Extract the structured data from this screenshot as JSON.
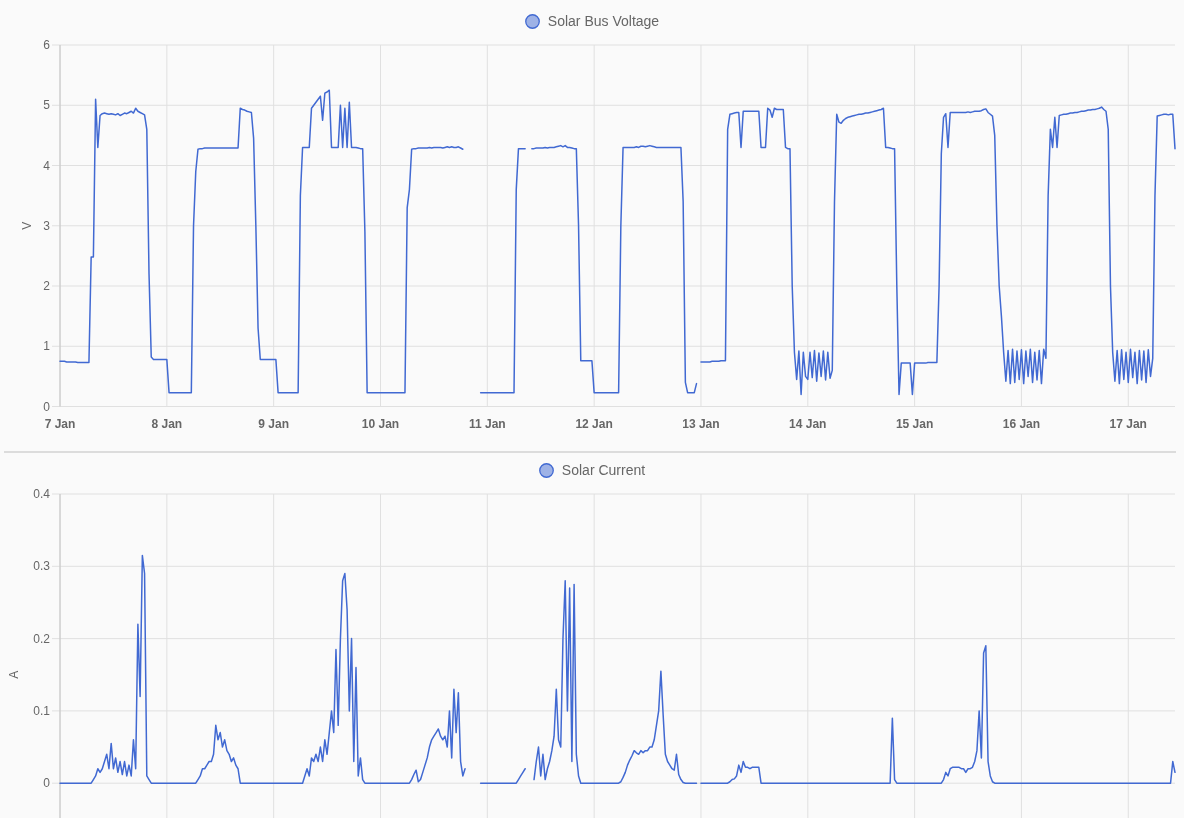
{
  "panels": [
    {
      "chart_data": {
        "type": "line",
        "ylabel": "V",
        "grid": true,
        "categories": [
          "7 Jan",
          null,
          null,
          null,
          null,
          null,
          null,
          null,
          null,
          null,
          null,
          null,
          null,
          null,
          null,
          null,
          null,
          null,
          null,
          null,
          null,
          null,
          null,
          null,
          null,
          null,
          null,
          null,
          null,
          null,
          null,
          null,
          null,
          null,
          null,
          null,
          null,
          null,
          null,
          null,
          null,
          null,
          null,
          null,
          null,
          null,
          null,
          null,
          "8 Jan",
          null,
          null,
          null,
          null,
          null,
          null,
          null,
          null,
          null,
          null,
          null,
          null,
          null,
          null,
          null,
          null,
          null,
          null,
          null,
          null,
          null,
          null,
          null,
          null,
          null,
          null,
          null,
          null,
          null,
          null,
          null,
          null,
          null,
          null,
          null,
          null,
          null,
          null,
          null,
          null,
          null,
          null,
          null,
          null,
          null,
          null,
          null,
          "9 Jan",
          null,
          null,
          null,
          null,
          null,
          null,
          null,
          null,
          null,
          null,
          null,
          null,
          null,
          null,
          null,
          null,
          null,
          null,
          null,
          null,
          null,
          null,
          null,
          null,
          null,
          null,
          null,
          null,
          null,
          null,
          null,
          null,
          null,
          null,
          null,
          null,
          null,
          null,
          null,
          null,
          null,
          null,
          null,
          null,
          null,
          null,
          null,
          "10 Jan",
          null,
          null,
          null,
          null,
          null,
          null,
          null,
          null,
          null,
          null,
          null,
          null,
          null,
          null,
          null,
          null,
          null,
          null,
          null,
          null,
          null,
          null,
          null,
          null,
          null,
          null,
          null,
          null,
          null,
          null,
          null,
          null,
          null,
          null,
          null,
          null,
          null,
          null,
          null,
          null,
          null,
          null,
          null,
          null,
          null,
          null,
          null,
          "11 Jan",
          null,
          null,
          null,
          null,
          null,
          null,
          null,
          null,
          null,
          null,
          null,
          null,
          null,
          null,
          null,
          null,
          null,
          null,
          null,
          null,
          null,
          null,
          null,
          null,
          null,
          null,
          null,
          null,
          null,
          null,
          null,
          null,
          null,
          null,
          null,
          null,
          null,
          null,
          null,
          null,
          null,
          null,
          null,
          null,
          null,
          null,
          null,
          "12 Jan",
          null,
          null,
          null,
          null,
          null,
          null,
          null,
          null,
          null,
          null,
          null,
          null,
          null,
          null,
          null,
          null,
          null,
          null,
          null,
          null,
          null,
          null,
          null,
          null,
          null,
          null,
          null,
          null,
          null,
          null,
          null,
          null,
          null,
          null,
          null,
          null,
          null,
          null,
          null,
          null,
          null,
          null,
          null,
          null,
          null,
          null,
          null,
          "13 Jan",
          null,
          null,
          null,
          null,
          null,
          null,
          null,
          null,
          null,
          null,
          null,
          null,
          null,
          null,
          null,
          null,
          null,
          null,
          null,
          null,
          null,
          null,
          null,
          null,
          null,
          null,
          null,
          null,
          null,
          null,
          null,
          null,
          null,
          null,
          null,
          null,
          null,
          null,
          null,
          null,
          null,
          null,
          null,
          null,
          null,
          null,
          null,
          "14 Jan",
          null,
          null,
          null,
          null,
          null,
          null,
          null,
          null,
          null,
          null,
          null,
          null,
          null,
          null,
          null,
          null,
          null,
          null,
          null,
          null,
          null,
          null,
          null,
          null,
          null,
          null,
          null,
          null,
          null,
          null,
          null,
          null,
          null,
          null,
          null,
          null,
          null,
          null,
          null,
          null,
          null,
          null,
          null,
          null,
          null,
          null,
          null,
          "15 Jan",
          null,
          null,
          null,
          null,
          null,
          null,
          null,
          null,
          null,
          null,
          null,
          null,
          null,
          null,
          null,
          null,
          null,
          null,
          null,
          null,
          null,
          null,
          null,
          null,
          null,
          null,
          null,
          null,
          null,
          null,
          null,
          null,
          null,
          null,
          null,
          null,
          null,
          null,
          null,
          null,
          null,
          null,
          null,
          null,
          null,
          null,
          null,
          "16 Jan",
          null,
          null,
          null,
          null,
          null,
          null,
          null,
          null,
          null,
          null,
          null,
          null,
          null,
          null,
          null,
          null,
          null,
          null,
          null,
          null,
          null,
          null,
          null,
          null,
          null,
          null,
          null,
          null,
          null,
          null,
          null,
          null,
          null,
          null,
          null,
          null,
          null,
          null,
          null,
          null,
          null,
          null,
          null,
          null,
          null,
          null,
          null,
          "17 Jan",
          null,
          null,
          null,
          null,
          null,
          null,
          null,
          null,
          null,
          null,
          null,
          null,
          null,
          null,
          null,
          null,
          null,
          null,
          null,
          null,
          null
        ],
        "series": [
          {
            "name": "Solar Bus Voltage",
            "color": "#4169d2",
            "values": [
              0.75,
              0.75,
              0.75,
              0.74,
              0.74,
              0.74,
              0.74,
              0.74,
              0.73,
              0.73,
              0.73,
              0.73,
              0.73,
              0.73,
              2.48,
              2.48,
              5.1,
              4.3,
              4.83,
              4.86,
              4.87,
              4.86,
              4.85,
              4.86,
              4.85,
              4.84,
              4.86,
              4.83,
              4.85,
              4.87,
              4.86,
              4.88,
              4.9,
              4.87,
              4.95,
              4.9,
              4.88,
              4.86,
              4.84,
              4.6,
              2.2,
              0.82,
              0.78,
              0.78,
              0.78,
              0.78,
              0.78,
              0.78,
              0.78,
              0.23,
              0.23,
              0.23,
              0.23,
              0.23,
              0.23,
              0.23,
              0.23,
              0.23,
              0.23,
              0.23,
              3,
              3.9,
              4.27,
              4.28,
              4.28,
              4.29,
              4.29,
              4.29,
              4.29,
              4.29,
              4.29,
              4.29,
              4.29,
              4.29,
              4.29,
              4.29,
              4.29,
              4.29,
              4.29,
              4.29,
              4.29,
              4.95,
              4.93,
              4.92,
              4.9,
              4.89,
              4.88,
              4.45,
              3,
              1.3,
              0.78,
              0.78,
              0.78,
              0.78,
              0.78,
              0.78,
              0.78,
              0.78,
              0.23,
              0.23,
              0.23,
              0.23,
              0.23,
              0.23,
              0.23,
              0.23,
              0.23,
              0.23,
              3.5,
              4.3,
              4.3,
              4.3,
              4.3,
              4.95,
              5,
              5.05,
              5.1,
              5.15,
              4.75,
              5.2,
              5.22,
              5.25,
              4.3,
              4.3,
              4.3,
              4.3,
              5,
              4.3,
              4.95,
              4.3,
              5.05,
              4.3,
              4.3,
              4.3,
              4.29,
              4.28,
              4.28,
              2.9,
              0.23,
              0.23,
              0.23,
              0.23,
              0.23,
              0.23,
              0.23,
              0.23,
              0.23,
              0.23,
              0.23,
              0.23,
              0.23,
              0.23,
              0.23,
              0.23,
              0.23,
              0.23,
              3.3,
              3.6,
              4.27,
              4.28,
              4.28,
              4.29,
              4.29,
              4.29,
              4.29,
              4.29,
              4.3,
              4.29,
              4.3,
              4.3,
              4.3,
              4.3,
              4.29,
              4.3,
              4.31,
              4.3,
              4.31,
              4.3,
              4.3,
              4.31,
              4.29,
              4.27,
              null,
              null,
              null,
              null,
              null,
              null,
              null,
              0.23,
              0.23,
              0.23,
              0.23,
              0.23,
              0.23,
              0.23,
              0.23,
              0.23,
              0.23,
              0.23,
              0.23,
              0.23,
              0.23,
              0.23,
              0.23,
              3.6,
              4.28,
              4.28,
              4.28,
              4.28,
              null,
              null,
              4.28,
              4.28,
              4.29,
              4.29,
              4.29,
              4.29,
              4.3,
              4.29,
              4.3,
              4.3,
              4.3,
              4.31,
              4.32,
              4.33,
              4.31,
              4.33,
              4.3,
              4.3,
              4.29,
              4.28,
              4.28,
              3,
              0.76,
              0.76,
              0.76,
              0.76,
              0.76,
              0.76,
              0.23,
              0.23,
              0.23,
              0.23,
              0.23,
              0.23,
              0.23,
              0.23,
              0.23,
              0.23,
              0.23,
              0.23,
              3,
              4.3,
              4.3,
              4.3,
              4.3,
              4.3,
              4.3,
              4.31,
              4.3,
              4.32,
              4.32,
              4.31,
              4.32,
              4.33,
              4.32,
              4.31,
              4.3,
              4.3,
              4.3,
              4.3,
              4.3,
              4.3,
              4.3,
              4.3,
              4.3,
              4.3,
              4.3,
              4.3,
              3.4,
              0.4,
              0.23,
              0.23,
              0.23,
              0.23,
              0.38,
              null,
              0.74,
              0.74,
              0.74,
              0.74,
              0.74,
              0.75,
              0.75,
              0.75,
              0.75,
              0.76,
              0.76,
              0.76,
              4.6,
              4.85,
              4.86,
              4.87,
              4.88,
              4.88,
              4.3,
              4.9,
              4.9,
              4.9,
              4.9,
              4.9,
              4.9,
              4.9,
              4.9,
              4.3,
              4.3,
              4.3,
              4.95,
              4.92,
              4.8,
              4.95,
              4.93,
              4.93,
              4.93,
              4.93,
              4.3,
              4.28,
              4.28,
              2,
              0.9,
              0.45,
              0.92,
              0.2,
              0.9,
              0.5,
              0.45,
              0.9,
              0.48,
              0.93,
              0.42,
              0.89,
              0.5,
              0.92,
              0.44,
              0.9,
              0.47,
              0.6,
              3.4,
              4.85,
              4.72,
              4.7,
              4.75,
              4.78,
              4.8,
              4.81,
              4.82,
              4.83,
              4.84,
              4.85,
              4.85,
              4.86,
              4.87,
              4.87,
              4.88,
              4.89,
              4.9,
              4.91,
              4.92,
              4.93,
              4.95,
              4.3,
              4.3,
              4.29,
              4.28,
              4.28,
              2,
              0.2,
              0.72,
              0.72,
              0.72,
              0.72,
              0.72,
              0.2,
              0.72,
              0.72,
              0.72,
              0.72,
              0.72,
              0.72,
              0.73,
              0.73,
              0.73,
              0.73,
              0.73,
              2,
              4.2,
              4.8,
              4.86,
              4.3,
              4.88,
              4.88,
              4.88,
              4.88,
              4.88,
              4.88,
              4.88,
              4.88,
              4.89,
              4.88,
              4.89,
              4.9,
              4.9,
              4.9,
              4.91,
              4.93,
              4.94,
              4.88,
              4.85,
              4.82,
              4.5,
              3,
              2,
              1.5,
              0.9,
              0.42,
              0.93,
              0.38,
              0.95,
              0.4,
              0.92,
              0.45,
              0.94,
              0.38,
              0.92,
              0.5,
              0.95,
              0.4,
              0.9,
              0.44,
              0.93,
              0.38,
              0.95,
              0.8,
              3.5,
              4.6,
              4.3,
              4.8,
              4.3,
              4.83,
              4.84,
              4.85,
              4.85,
              4.86,
              4.87,
              4.87,
              4.88,
              4.88,
              4.89,
              4.9,
              4.9,
              4.91,
              4.92,
              4.92,
              4.93,
              4.93,
              4.94,
              4.95,
              4.97,
              4.93,
              4.9,
              4.6,
              2,
              0.9,
              0.42,
              0.93,
              0.38,
              0.94,
              0.45,
              0.9,
              0.4,
              0.95,
              0.48,
              0.9,
              0.38,
              0.93,
              0.44,
              0.92,
              0.4,
              0.94,
              0.5,
              0.8,
              3.5,
              4.82,
              4.83,
              4.84,
              4.85,
              4.85,
              4.84,
              4.85,
              4.85,
              4.28
            ]
          }
        ],
        "ylim": [
          0,
          6
        ],
        "yticks": [
          0,
          1,
          2,
          3,
          4,
          5,
          6
        ]
      }
    },
    {
      "chart_data": {
        "type": "line",
        "ylabel": "A",
        "grid": true,
        "categories": [
          null,
          null,
          null,
          null,
          null,
          null,
          null,
          null,
          null,
          null,
          null,
          null,
          null,
          null,
          null,
          null,
          null,
          null,
          null,
          null,
          null,
          null,
          null,
          null,
          null,
          null,
          null,
          null,
          null,
          null,
          null,
          null,
          null,
          null,
          null,
          null,
          null,
          null,
          null,
          null,
          null,
          null,
          null,
          null,
          null,
          null,
          null,
          null,
          null,
          null,
          null,
          null,
          null,
          null,
          null,
          null,
          null,
          null,
          null,
          null,
          null,
          null,
          null,
          null,
          null,
          null,
          null,
          null,
          null,
          null,
          null,
          null,
          null,
          null,
          null,
          null,
          null,
          null,
          null,
          null,
          null,
          null,
          null,
          null,
          null,
          null,
          null,
          null,
          null,
          null,
          null,
          null,
          null,
          null,
          null,
          null,
          null,
          null,
          null,
          null,
          null,
          null,
          null,
          null,
          null,
          null,
          null,
          null,
          null,
          null,
          null,
          null,
          null,
          null,
          null,
          null,
          null,
          null,
          null,
          null,
          null,
          null,
          null,
          null,
          null,
          null,
          null,
          null,
          null,
          null,
          null,
          null,
          null,
          null,
          null,
          null,
          null,
          null,
          null,
          null,
          null,
          null,
          null,
          null,
          null,
          null,
          null,
          null,
          null,
          null,
          null,
          null,
          null,
          null,
          null,
          null,
          null,
          null,
          null,
          null,
          null,
          null,
          null,
          null,
          null,
          null,
          null,
          null,
          null,
          null,
          null,
          null,
          null,
          null,
          null,
          null,
          null,
          null,
          null,
          null,
          null,
          null,
          null,
          null,
          null,
          null,
          null,
          null,
          null,
          null,
          null,
          null,
          null,
          null,
          null,
          null,
          null,
          null,
          null,
          null,
          null,
          null,
          null,
          null,
          null,
          null,
          null,
          null,
          null,
          null,
          null,
          null,
          null,
          null,
          null,
          null,
          null,
          null,
          null,
          null,
          null,
          null,
          null,
          null,
          null,
          null,
          null,
          null,
          null,
          null,
          null,
          null,
          null,
          null,
          null,
          null,
          null,
          null,
          null,
          null,
          null,
          null,
          null,
          null,
          null,
          null,
          null,
          null,
          null,
          null,
          null,
          null,
          null,
          null,
          null,
          null,
          null,
          null,
          null,
          null,
          null,
          null,
          null,
          null,
          null,
          null,
          null,
          null,
          null,
          null,
          null,
          null,
          null,
          null,
          null,
          null,
          null,
          null,
          null,
          null,
          null,
          null,
          null,
          null,
          null,
          null,
          null,
          null,
          null,
          null,
          null,
          null,
          null,
          null,
          null,
          null,
          null,
          null,
          null,
          null,
          null,
          null,
          null,
          null,
          null,
          null,
          null,
          null,
          null,
          null,
          null,
          null,
          null,
          null,
          null,
          null,
          null,
          null,
          null,
          null,
          null,
          null,
          null,
          null,
          null,
          null,
          null,
          null,
          null,
          null,
          null,
          null,
          null,
          null,
          null,
          null,
          null,
          null,
          null,
          null,
          null,
          null,
          null,
          null,
          null,
          null,
          null,
          null,
          null,
          null,
          null,
          null,
          null,
          null,
          null,
          null,
          null,
          null,
          null,
          null,
          null,
          null,
          null,
          null,
          null,
          null,
          null,
          null,
          null,
          null,
          null,
          null,
          null,
          null,
          null,
          null,
          null,
          null,
          null,
          null,
          null,
          null,
          null,
          null,
          null,
          null,
          null,
          null,
          null,
          null,
          null,
          null,
          null,
          null,
          null,
          null,
          null,
          null,
          null,
          null,
          null,
          null,
          null,
          null,
          null,
          null,
          null,
          null,
          null,
          null,
          null,
          null,
          null,
          null,
          null,
          null,
          null,
          null,
          null,
          null,
          null,
          null,
          null,
          null,
          null,
          null,
          null,
          null,
          null,
          null,
          null,
          null,
          null,
          null,
          null,
          null,
          null,
          null,
          null,
          null,
          null,
          null,
          null,
          null,
          null,
          null,
          null,
          null,
          null,
          null,
          null,
          null,
          null,
          null,
          null,
          null,
          null,
          null,
          null,
          null,
          null,
          null,
          null,
          null,
          null,
          null,
          null,
          null,
          null,
          null,
          null,
          null,
          null,
          null,
          null,
          null,
          null,
          null,
          null,
          null,
          null,
          null,
          null,
          null,
          null,
          null,
          null,
          null,
          null,
          null,
          null,
          null,
          null,
          null,
          null,
          null,
          null,
          null,
          null,
          null,
          null,
          null
        ],
        "series": [
          {
            "name": "Solar Current",
            "color": "#4169d2",
            "values": [
              0,
              0,
              0,
              0,
              0,
              0,
              0,
              0,
              0,
              0,
              0,
              0,
              0,
              0,
              0,
              0.005,
              0.01,
              0.02,
              0.015,
              0.02,
              0.03,
              0.04,
              0.02,
              0.055,
              0.02,
              0.035,
              0.015,
              0.03,
              0.012,
              0.03,
              0.01,
              0.025,
              0.01,
              0.06,
              0.02,
              0.22,
              0.12,
              0.315,
              0.29,
              0.01,
              0.005,
              0,
              0,
              0,
              0,
              0,
              0,
              0,
              0,
              0,
              0,
              0,
              0,
              0,
              0,
              0,
              0,
              0,
              0,
              0,
              0,
              0,
              0.005,
              0.01,
              0.02,
              0.02,
              0.025,
              0.03,
              0.03,
              0.04,
              0.08,
              0.06,
              0.07,
              0.05,
              0.06,
              0.045,
              0.04,
              0.03,
              0.035,
              0.025,
              0.02,
              0,
              0,
              0,
              0,
              0,
              0,
              0,
              0,
              0,
              0,
              0,
              0,
              0,
              0,
              0,
              0,
              0,
              0,
              0,
              0,
              0,
              0,
              0,
              0,
              0,
              0,
              0,
              0,
              0,
              0.01,
              0.02,
              0.01,
              0.035,
              0.03,
              0.04,
              0.03,
              0.05,
              0.03,
              0.06,
              0.04,
              0.07,
              0.1,
              0.07,
              0.185,
              0.08,
              0.2,
              0.28,
              0.29,
              0.24,
              0.1,
              0.2,
              0.03,
              0.16,
              0.01,
              0.035,
              0.005,
              0,
              0,
              0,
              0,
              0,
              0,
              0,
              0,
              0,
              0,
              0,
              0,
              0,
              0,
              0,
              0,
              0,
              0,
              0,
              0,
              0,
              0.005,
              0.012,
              0.018,
              0.002,
              0.005,
              0.015,
              0.025,
              0.035,
              0.05,
              0.06,
              0.065,
              0.07,
              0.075,
              0.065,
              0.06,
              0.065,
              0.05,
              0.1,
              0.035,
              0.13,
              0.07,
              0.125,
              0.03,
              0.01,
              0.02,
              null,
              null,
              null,
              null,
              null,
              null,
              0,
              0,
              0,
              0,
              0,
              0,
              0,
              0,
              0,
              0,
              0,
              0,
              0,
              0,
              0,
              0,
              0,
              0.005,
              0.01,
              0.015,
              0.02,
              null,
              null,
              null,
              0.005,
              0.03,
              0.05,
              0.01,
              0.04,
              0.005,
              0.02,
              0.03,
              0.045,
              0.065,
              0.13,
              0.06,
              0.05,
              0.2,
              0.28,
              0.1,
              0.27,
              0.03,
              0.275,
              0.04,
              0.01,
              0,
              0,
              0,
              0,
              0,
              0,
              0,
              0,
              0,
              0,
              0,
              0,
              0,
              0,
              0,
              0,
              0,
              0,
              0.002,
              0.008,
              0.015,
              0.025,
              0.032,
              0.038,
              0.045,
              0.042,
              0.04,
              0.045,
              0.042,
              0.045,
              0.045,
              0.05,
              0.05,
              0.06,
              0.08,
              0.1,
              0.155,
              0.095,
              0.04,
              0.03,
              0.025,
              0.02,
              0.018,
              0.04,
              0.012,
              0.005,
              0.001,
              0,
              0,
              0,
              0,
              0,
              0,
              null,
              0,
              0,
              0,
              0,
              0,
              0,
              0,
              0,
              0,
              0,
              0,
              0,
              0,
              0.002,
              0.005,
              0.006,
              0.01,
              0.025,
              0.015,
              0.03,
              0.022,
              0.022,
              0.02,
              0.022,
              0.022,
              0.022,
              0.022,
              0,
              0,
              0,
              0,
              0,
              0,
              0,
              0,
              0,
              0,
              0,
              0,
              0,
              0,
              0,
              0,
              0,
              0,
              0,
              0,
              0,
              0,
              0,
              0,
              0,
              0,
              0,
              0,
              0,
              0,
              0,
              0,
              0,
              0,
              0,
              0,
              0,
              0,
              0,
              0,
              0,
              0,
              0,
              0,
              0,
              0,
              0,
              0,
              0,
              0,
              0,
              0,
              0,
              0,
              0,
              0,
              0,
              0,
              0,
              0.09,
              0.005,
              0,
              0,
              0,
              0,
              0,
              0,
              0,
              0,
              0,
              0,
              0,
              0,
              0,
              0,
              0,
              0,
              0,
              0,
              0,
              0,
              0,
              0.005,
              0.015,
              0.01,
              0.02,
              0.022,
              0.022,
              0.022,
              0.022,
              0.02,
              0.02,
              0.015,
              0.02,
              0.02,
              0.022,
              0.03,
              0.045,
              0.1,
              0.035,
              0.18,
              0.19,
              0.03,
              0.01,
              0.002,
              0,
              0,
              0,
              0,
              0,
              0,
              0,
              0,
              0,
              0,
              0,
              0,
              0,
              0,
              0,
              0,
              0,
              0,
              0,
              0,
              0,
              0,
              0,
              0,
              0,
              0,
              0,
              0,
              0,
              0,
              0,
              0,
              0,
              0,
              0,
              0,
              0,
              0,
              0,
              0,
              0,
              0,
              0,
              0,
              0,
              0,
              0,
              0,
              0,
              0,
              0,
              0,
              0,
              0,
              0,
              0,
              0,
              0,
              0,
              0,
              0,
              0,
              0,
              0,
              0,
              0,
              0,
              0,
              0,
              0,
              0,
              0,
              0,
              0,
              0,
              0,
              0,
              0,
              0,
              0,
              0.03,
              0.015
            ]
          }
        ],
        "ylim": [
          -0.1,
          0.4
        ],
        "yticks": [
          0,
          0.1,
          0.2,
          0.3,
          0.4
        ]
      }
    }
  ]
}
